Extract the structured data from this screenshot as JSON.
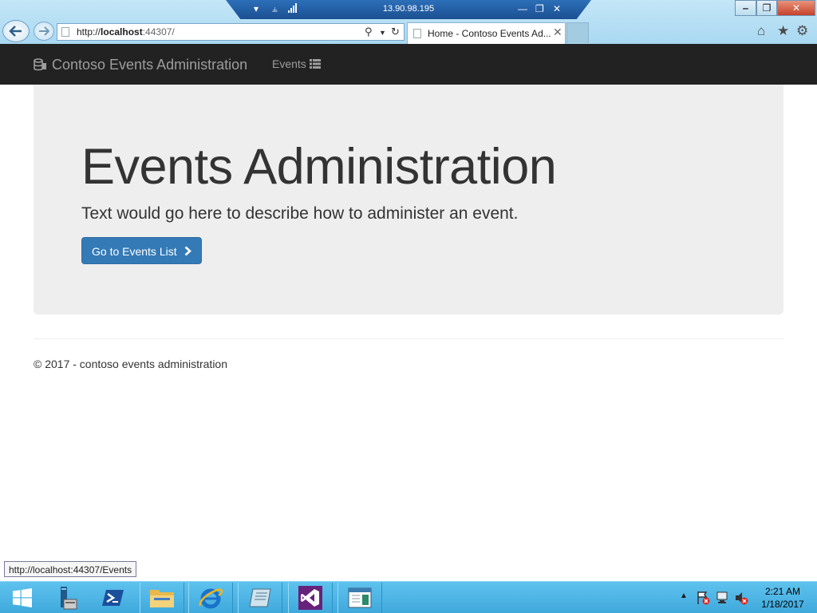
{
  "remote_session": {
    "host_ip": "13.90.98.195"
  },
  "browser": {
    "address": {
      "scheme": "http://",
      "host": "localhost",
      "port": ":44307/"
    },
    "tab_title": "Home - Contoso Events Ad...",
    "tab_close": "✕"
  },
  "window_controls": {
    "minimize": "‒",
    "restore": "❐",
    "close": "✕"
  },
  "site": {
    "brand": "Contoso Events Administration",
    "nav": {
      "events_label": "Events"
    },
    "jumbotron": {
      "title": "Events Administration",
      "lead": "Text would go here to describe how to administer an event.",
      "button_label": "Go to Events List"
    },
    "footer": "© 2017 - contoso events administration"
  },
  "status_bar_url": "http://localhost:44307/Events",
  "taskbar": {
    "pinned": [
      "start-icon",
      "server-manager-icon",
      "powershell-icon",
      "file-explorer-icon",
      "internet-explorer-icon",
      "notepad-icon",
      "visual-studio-icon",
      "app-window-icon"
    ],
    "clock": {
      "time": "2:21 AM",
      "date": "1/18/2017"
    }
  },
  "colors": {
    "navbar": "#222222",
    "jumbotron": "#eeeeee",
    "primary_button": "#337ab7",
    "taskbar": "#4cb6e6"
  }
}
